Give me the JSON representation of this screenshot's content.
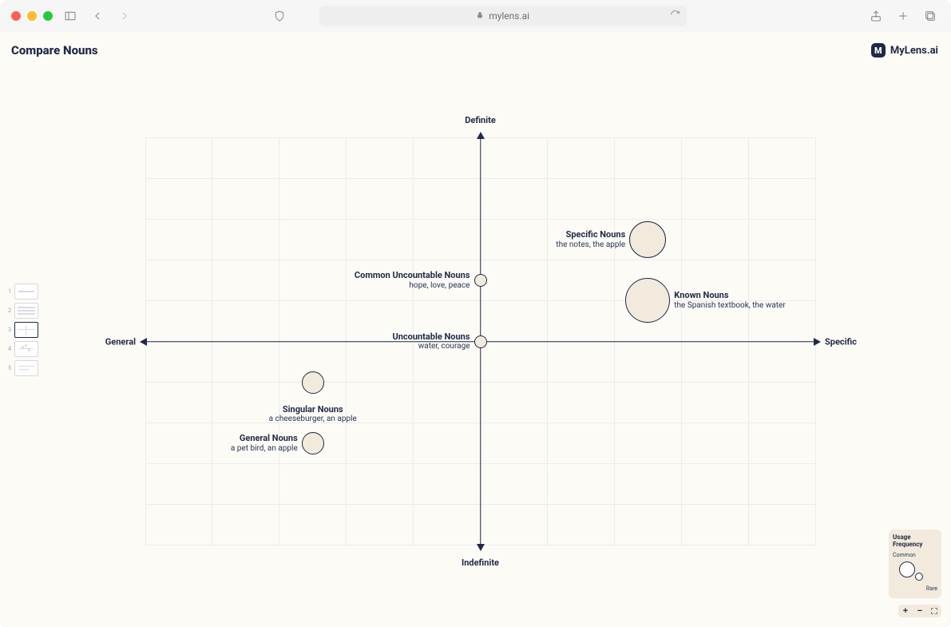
{
  "browser": {
    "url_host": "mylens.ai"
  },
  "page": {
    "title": "Compare Nouns",
    "brand": "MyLens.ai"
  },
  "thumbnails": {
    "count": 5,
    "active_index": 3
  },
  "axes": {
    "top": "Definite",
    "bottom": "Indefinite",
    "left": "General",
    "right": "Specific"
  },
  "legend": {
    "title_line1": "Usage",
    "title_line2": "Frequency",
    "max_label": "Common",
    "min_label": "Rare"
  },
  "chart_data": {
    "type": "scatter",
    "x_axis": {
      "label_negative": "General",
      "label_positive": "Specific",
      "range": [
        -5,
        5
      ]
    },
    "y_axis": {
      "label_negative": "Indefinite",
      "label_positive": "Definite",
      "range": [
        -5,
        5
      ]
    },
    "size_encoding": "Usage Frequency",
    "points": [
      {
        "id": "specific-nouns",
        "title": "Specific Nouns",
        "subtitle": "the notes, the apple",
        "x": 2.5,
        "y": 2.5,
        "size": 3,
        "label_side": "left"
      },
      {
        "id": "common-uncountable-nouns",
        "title": "Common Uncountable Nouns",
        "subtitle": "hope, love, peace",
        "x": 0.0,
        "y": 1.5,
        "size": 1,
        "label_side": "left"
      },
      {
        "id": "known-nouns",
        "title": "Known Nouns",
        "subtitle": "the Spanish textbook, the water",
        "x": 2.5,
        "y": 1.0,
        "size": 4,
        "label_side": "right"
      },
      {
        "id": "uncountable-nouns",
        "title": "Uncountable Nouns",
        "subtitle": "water, courage",
        "x": 0.0,
        "y": 0.0,
        "size": 1,
        "label_side": "left"
      },
      {
        "id": "singular-nouns",
        "title": "Singular Nouns",
        "subtitle": "a cheeseburger, an apple",
        "x": -2.5,
        "y": -1.0,
        "size": 2,
        "label_side": "left",
        "label_below": true
      },
      {
        "id": "general-nouns",
        "title": "General Nouns",
        "subtitle": "a pet bird, an apple",
        "x": -2.5,
        "y": -2.5,
        "size": 2,
        "label_side": "left"
      }
    ]
  }
}
